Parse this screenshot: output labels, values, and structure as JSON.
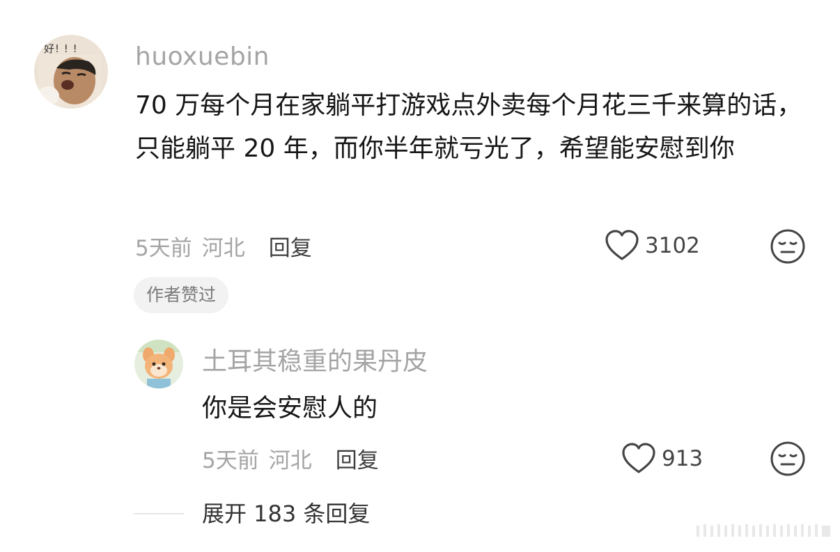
{
  "comment": {
    "avatar_caption": "好! ! !",
    "username": "huoxuebin",
    "text": "70 万每个月在家躺平打游戏点外卖每个月花三千来算的话，只能躺平 20 年，而你半年就亏光了，希望能安慰到你",
    "time": "5天前",
    "location": "河北",
    "reply_label": "回复",
    "like_count": "3102",
    "author_badge": "作者赞过"
  },
  "reply": {
    "username": "土耳其稳重的果丹皮",
    "text": "你是会安慰人的",
    "time": "5天前",
    "location": "河北",
    "reply_label": "回复",
    "like_count": "913"
  },
  "expand": {
    "label": "展开 183 条回复"
  },
  "icons": {
    "like": "heart-outline-icon",
    "dislike": "meh-face-icon"
  },
  "colors": {
    "primary_text": "#161616",
    "secondary_text": "#a4a4a4",
    "badge_bg": "#f2f2f2"
  }
}
